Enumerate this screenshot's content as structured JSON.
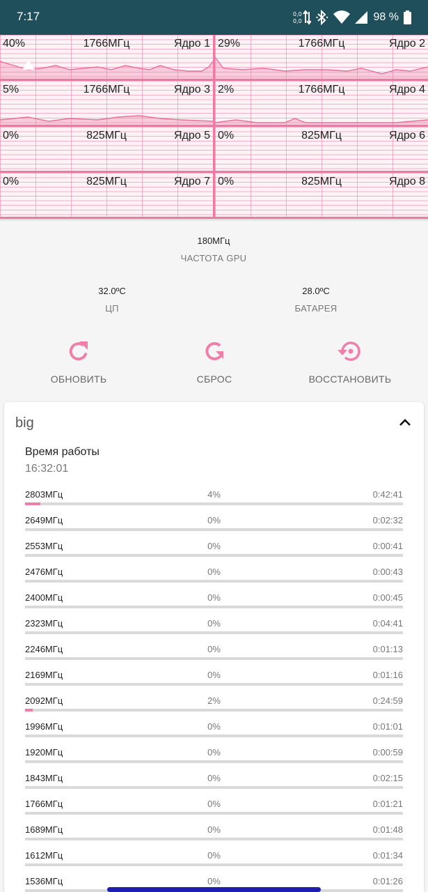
{
  "status_bar": {
    "time": "7:17",
    "battery": "98 %"
  },
  "cores": [
    {
      "load": "40%",
      "freq": "1766МГц",
      "name": "Ядро 1"
    },
    {
      "load": "29%",
      "freq": "1766МГц",
      "name": "Ядро 2"
    },
    {
      "load": "5%",
      "freq": "1766МГц",
      "name": "Ядро 3"
    },
    {
      "load": "2%",
      "freq": "1766МГц",
      "name": "Ядро 4"
    },
    {
      "load": "0%",
      "freq": "825МГц",
      "name": "Ядро 5"
    },
    {
      "load": "0%",
      "freq": "825МГц",
      "name": "Ядро 6"
    },
    {
      "load": "0%",
      "freq": "825МГц",
      "name": "Ядро 7"
    },
    {
      "load": "0%",
      "freq": "825МГц",
      "name": "Ядро 8"
    }
  ],
  "gpu": {
    "value": "180МГц",
    "label": "ЧАСТОТА GPU"
  },
  "temps": {
    "cpu": {
      "value": "32.0ºC",
      "label": "ЦП"
    },
    "battery": {
      "value": "28.0ºC",
      "label": "БАТАРЕЯ"
    }
  },
  "actions": {
    "refresh": "ОБНОВИТЬ",
    "reset": "СБРОС",
    "restore": "ВОССТАНОВИТЬ"
  },
  "accent_color": "#ef7fa8",
  "cluster": {
    "title": "big",
    "uptime_label": "Время работы",
    "uptime_value": "16:32:01",
    "states": [
      {
        "freq": "2803МГц",
        "pct": "4%",
        "time": "0:42:41",
        "share": 0.04
      },
      {
        "freq": "2649МГц",
        "pct": "0%",
        "time": "0:02:32",
        "share": 0
      },
      {
        "freq": "2553МГц",
        "pct": "0%",
        "time": "0:00:41",
        "share": 0
      },
      {
        "freq": "2476МГц",
        "pct": "0%",
        "time": "0:00:43",
        "share": 0
      },
      {
        "freq": "2400МГц",
        "pct": "0%",
        "time": "0:00:45",
        "share": 0
      },
      {
        "freq": "2323МГц",
        "pct": "0%",
        "time": "0:04:41",
        "share": 0
      },
      {
        "freq": "2246МГц",
        "pct": "0%",
        "time": "0:01:13",
        "share": 0
      },
      {
        "freq": "2169МГц",
        "pct": "0%",
        "time": "0:01:16",
        "share": 0
      },
      {
        "freq": "2092МГц",
        "pct": "2%",
        "time": "0:24:59",
        "share": 0.02
      },
      {
        "freq": "1996МГц",
        "pct": "0%",
        "time": "0:01:01",
        "share": 0
      },
      {
        "freq": "1920МГц",
        "pct": "0%",
        "time": "0:00:59",
        "share": 0
      },
      {
        "freq": "1843МГц",
        "pct": "0%",
        "time": "0:02:15",
        "share": 0
      },
      {
        "freq": "1766МГц",
        "pct": "0%",
        "time": "0:01:21",
        "share": 0
      },
      {
        "freq": "1689МГц",
        "pct": "0%",
        "time": "0:01:48",
        "share": 0
      },
      {
        "freq": "1612МГц",
        "pct": "0%",
        "time": "0:01:34",
        "share": 0
      },
      {
        "freq": "1536МГц",
        "pct": "0%",
        "time": "0:01:26",
        "share": 0
      }
    ]
  }
}
